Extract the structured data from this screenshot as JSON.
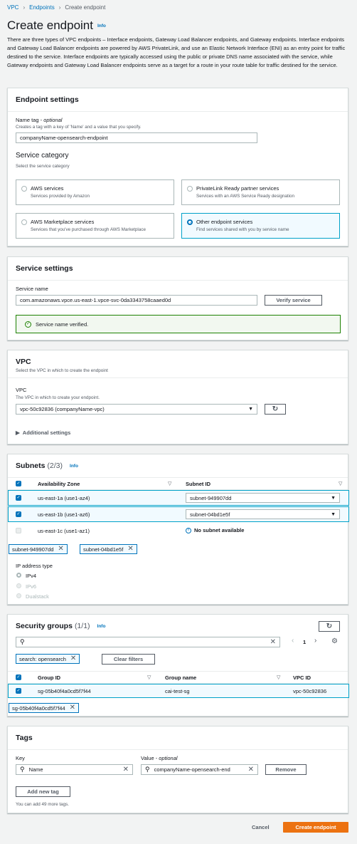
{
  "breadcrumb": {
    "items": [
      "VPC",
      "Endpoints"
    ],
    "current": "Create endpoint"
  },
  "page": {
    "title": "Create endpoint",
    "info": "Info",
    "intro": "There are three types of VPC endpoints – Interface endpoints, Gateway Load Balancer endpoints, and Gateway endpoints. Interface endpoints and Gateway Load Balancer endpoints are powered by AWS PrivateLink, and use an Elastic Network Interface (ENI) as an entry point for traffic destined to the service. Interface endpoints are typically accessed using the public or private DNS name associated with the service, while Gateway endpoints and Gateway Load Balancer endpoints serve as a target for a route in your route table for traffic destined for the service."
  },
  "endpoint_settings": {
    "header": "Endpoint settings",
    "name_tag_label": "Name tag - ",
    "name_tag_optional": "optional",
    "name_tag_desc": "Creates a tag with a key of 'Name' and a value that you specify.",
    "name_tag_value": "companyName-opensearch-endpoint",
    "category_title": "Service category",
    "category_desc": "Select the service category",
    "options": [
      {
        "title": "AWS services",
        "desc": "Services provided by Amazon"
      },
      {
        "title": "PrivateLink Ready partner services",
        "desc": "Services with an AWS Service Ready designation"
      },
      {
        "title": "AWS Marketplace services",
        "desc": "Services that you've purchased through AWS Marketplace"
      },
      {
        "title": "Other endpoint services",
        "desc": "Find services shared with you by service name"
      }
    ],
    "selected_option": 3
  },
  "service_settings": {
    "header": "Service settings",
    "service_name_label": "Service name",
    "service_name_value": "com.amazonaws.vpce.us-east-1.vpce-svc-0da3343758caaed0d",
    "verify_button": "Verify service",
    "verified_msg": "Service name verified."
  },
  "vpc": {
    "header": "VPC",
    "header_desc": "Select the VPC in which to create the endpoint",
    "label": "VPC",
    "desc": "The VPC in which to create your endpoint.",
    "value": "vpc-50c92836 (companyName-vpc)",
    "additional": "Additional settings"
  },
  "subnets": {
    "title": "Subnets",
    "count": "(2/3)",
    "info": "Info",
    "col_az": "Availability Zone",
    "col_subnet": "Subnet ID",
    "rows": [
      {
        "az": "us-east-1a (use1-az4)",
        "subnet": "subnet-949907dd"
      },
      {
        "az": "us-east-1b (use1-az6)",
        "subnet": "subnet-04bd1e5f"
      },
      {
        "az": "us-east-1c (use1-az1)",
        "subnet": "No subnet available"
      }
    ],
    "tokens": [
      "subnet-949907dd",
      "subnet-04bd1e5f"
    ],
    "ip_type_label": "IP address type",
    "ip_options": [
      "IPv4",
      "IPv6",
      "Dualstack"
    ]
  },
  "security_groups": {
    "title": "Security groups",
    "count": "(1/1)",
    "info": "Info",
    "page_number": "1",
    "filter_token": "search: opensearch",
    "clear_filters": "Clear filters",
    "col_group_id": "Group ID",
    "col_group_name": "Group name",
    "col_vpc_id": "VPC ID",
    "rows": [
      {
        "id": "sg-05b40f4a0cd5f7f44",
        "name": "cai-test-sg",
        "vpc": "vpc-50c92836"
      }
    ],
    "token": "sg-05b40f4a0cd5f7f44"
  },
  "tags": {
    "header": "Tags",
    "key_label": "Key",
    "value_label": "Value - ",
    "value_optional": "optional",
    "key_value": "Name",
    "value_value": "companyName-opensearch-end",
    "remove_button": "Remove",
    "add_button": "Add new tag",
    "note": "You can add 49 more tags."
  },
  "footer": {
    "cancel": "Cancel",
    "create": "Create endpoint"
  },
  "colors": {
    "accent": "#0073bb",
    "primary": "#ec7211",
    "success": "#1d8102"
  },
  "icons": [
    "chevron-right-icon",
    "check-circle-icon",
    "caret-down-icon",
    "refresh-icon",
    "info-circle-icon",
    "close-icon",
    "search-icon",
    "settings-icon",
    "chevron-left-icon",
    "checkbox-icon"
  ]
}
